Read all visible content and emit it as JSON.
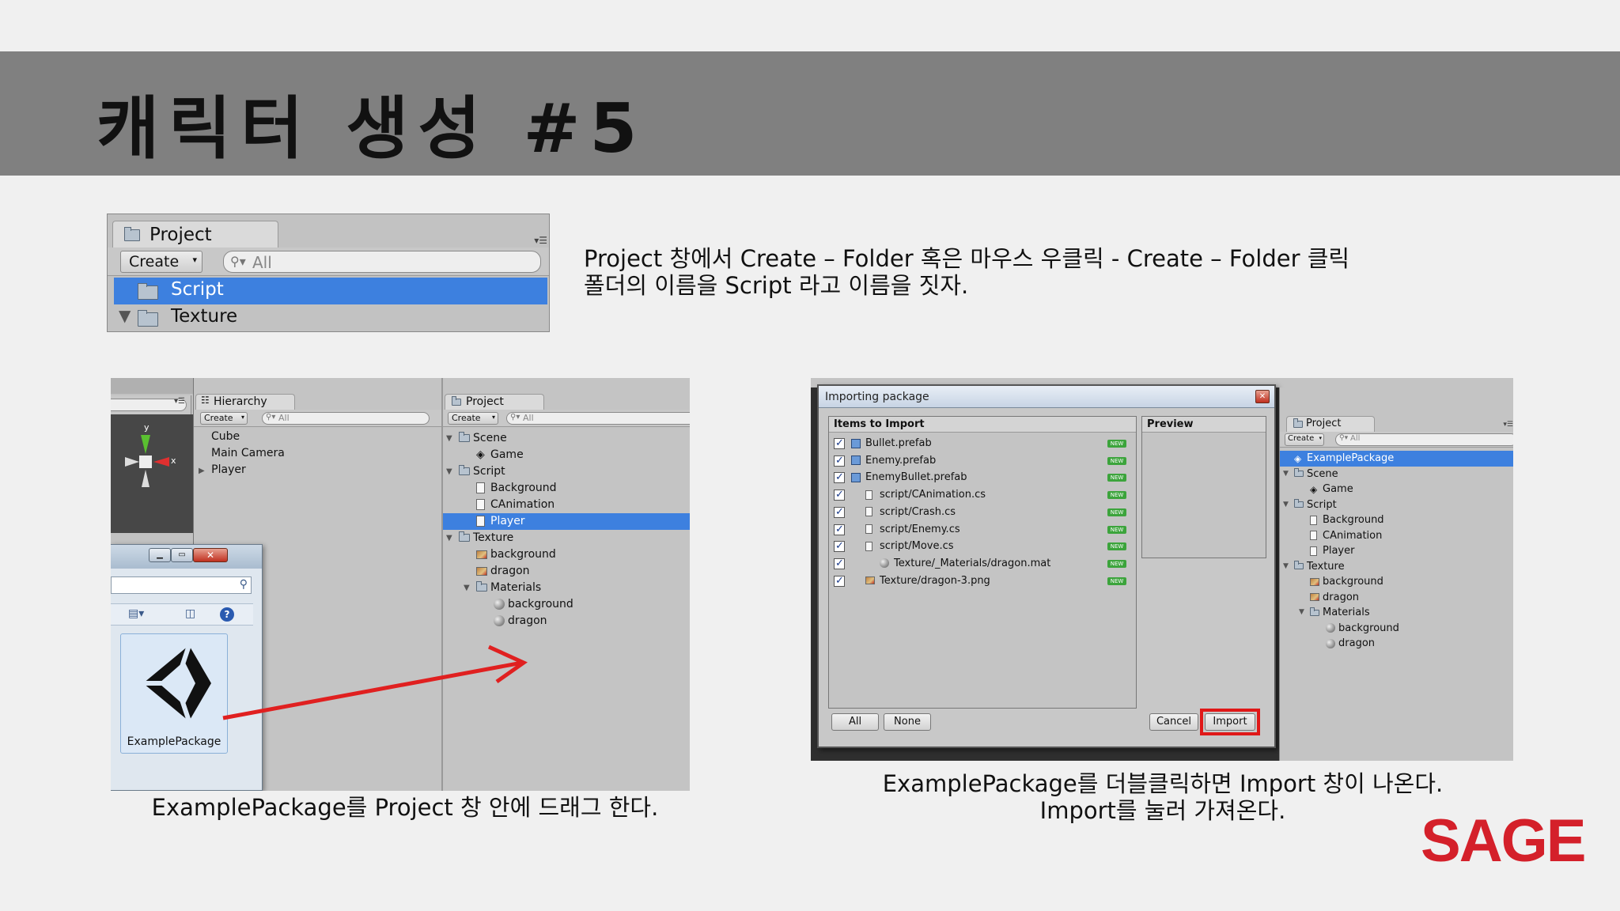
{
  "slide": {
    "title": "캐릭터 생성 #5",
    "desc_line1": "Project 창에서 Create – Folder 혹은 마우스 우클릭 - Create – Folder 클릭",
    "desc_line2": "폴더의 이름을 Script 라고 이름을 짓자.",
    "caption_left": "ExamplePackage를 Project 창 안에 드래그 한다.",
    "caption_right_line1": "ExamplePackage를 더블클릭하면 Import 창이 나온다.",
    "caption_right_line2": "Import를 눌러 가져온다.",
    "logo": "SAGE"
  },
  "colors": {
    "title_bar": "#808080",
    "selection": "#3d80df",
    "arrow": "#e02020",
    "logo": "#d4202a",
    "new_badge": "#3ca43c"
  },
  "panel1": {
    "tab": "Project",
    "create": "Create",
    "search": "All",
    "items": [
      "Script",
      "Texture"
    ]
  },
  "panel2": {
    "hierarchy_tab": "Hierarchy",
    "create": "Create",
    "search": "All",
    "hierarchy_items": [
      "Cube",
      "Main Camera",
      "Player"
    ],
    "project_tab": "Project",
    "project_tree": [
      {
        "label": "Scene",
        "kind": "folder",
        "depth": 0
      },
      {
        "label": "Game",
        "kind": "unity",
        "depth": 1
      },
      {
        "label": "Script",
        "kind": "folder",
        "depth": 0
      },
      {
        "label": "Background",
        "kind": "doc",
        "depth": 1
      },
      {
        "label": "CAnimation",
        "kind": "doc",
        "depth": 1
      },
      {
        "label": "Player",
        "kind": "doc",
        "depth": 1,
        "selected": true
      },
      {
        "label": "Texture",
        "kind": "folder",
        "depth": 0
      },
      {
        "label": "background",
        "kind": "image",
        "depth": 1
      },
      {
        "label": "dragon",
        "kind": "image",
        "depth": 1
      },
      {
        "label": "Materials",
        "kind": "folder",
        "depth": 1
      },
      {
        "label": "background",
        "kind": "ball",
        "depth": 2
      },
      {
        "label": "dragon",
        "kind": "ball",
        "depth": 2
      }
    ],
    "package_label": "ExamplePackage",
    "gizmo_y": "y",
    "gizmo_x": "x"
  },
  "panel3": {
    "dialog_title": "Importing package",
    "items_header": "Items to Import",
    "preview_header": "Preview",
    "items": [
      {
        "label": "Bullet.prefab",
        "kind": "prefab",
        "indent": 0
      },
      {
        "label": "Enemy.prefab",
        "kind": "prefab",
        "indent": 0
      },
      {
        "label": "EnemyBullet.prefab",
        "kind": "prefab",
        "indent": 0
      },
      {
        "label": "script/CAnimation.cs",
        "kind": "doc",
        "indent": 1
      },
      {
        "label": "script/Crash.cs",
        "kind": "doc",
        "indent": 1
      },
      {
        "label": "script/Enemy.cs",
        "kind": "doc",
        "indent": 1
      },
      {
        "label": "script/Move.cs",
        "kind": "doc",
        "indent": 1
      },
      {
        "label": "Texture/_Materials/dragon.mat",
        "kind": "ball",
        "indent": 2
      },
      {
        "label": "Texture/dragon-3.png",
        "kind": "image",
        "indent": 1
      }
    ],
    "new_badge": "NEW",
    "btn_all": "All",
    "btn_none": "None",
    "btn_cancel": "Cancel",
    "btn_import": "Import",
    "project_tab": "Project",
    "create": "Create",
    "search": "All",
    "project_tree": [
      {
        "label": "ExamplePackage",
        "kind": "unity",
        "depth": 0,
        "selected": true
      },
      {
        "label": "Scene",
        "kind": "folder",
        "depth": 0
      },
      {
        "label": "Game",
        "kind": "unity",
        "depth": 1
      },
      {
        "label": "Script",
        "kind": "folder",
        "depth": 0
      },
      {
        "label": "Background",
        "kind": "doc",
        "depth": 1
      },
      {
        "label": "CAnimation",
        "kind": "doc",
        "depth": 1
      },
      {
        "label": "Player",
        "kind": "doc",
        "depth": 1
      },
      {
        "label": "Texture",
        "kind": "folder",
        "depth": 0
      },
      {
        "label": "background",
        "kind": "image",
        "depth": 1
      },
      {
        "label": "dragon",
        "kind": "image",
        "depth": 1
      },
      {
        "label": "Materials",
        "kind": "folder",
        "depth": 1
      },
      {
        "label": "background",
        "kind": "ball",
        "depth": 2
      },
      {
        "label": "dragon",
        "kind": "ball",
        "depth": 2
      }
    ]
  }
}
